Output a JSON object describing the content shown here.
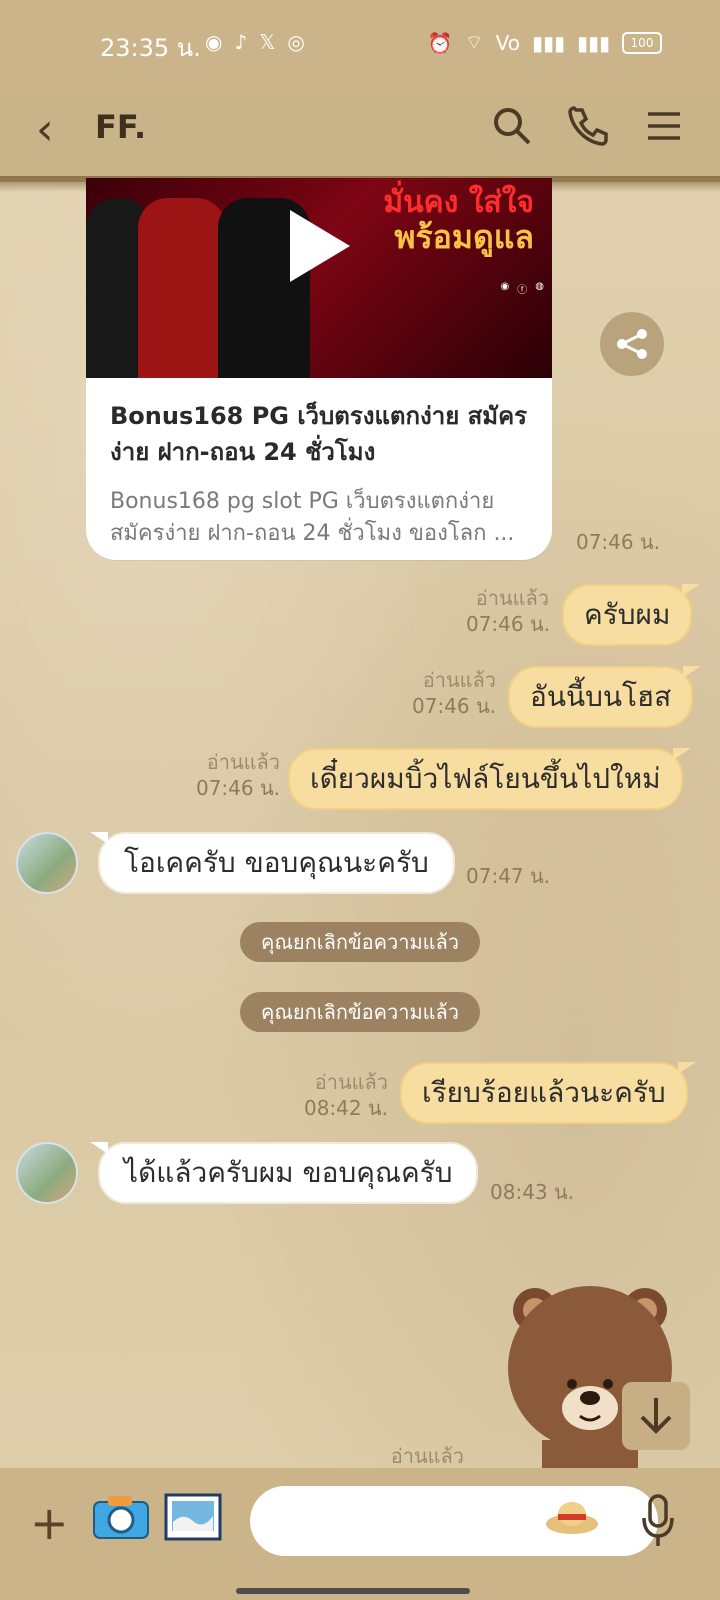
{
  "status_bar": {
    "time": "23:35 น.",
    "apps": [
      "messenger-icon",
      "tiktok-icon",
      "x-icon",
      "instagram-icon"
    ],
    "battery": "100"
  },
  "header": {
    "title": "FF."
  },
  "shared_video": {
    "banner_red": "มั่นคง ใส่ใจ",
    "banner_gold": "พร้อมดูแล",
    "title": "Bonus168 PG เว็บตรงแตกง่าย สมัครง่าย ฝาก-ถอน 24 ชั่วโมง",
    "description": "Bonus168 pg slot PG เว็บตรงแตกง่าย สมัครง่าย ฝาก-ถอน 24 ชั่วโมง ของโลก ...",
    "time": "07:46 น."
  },
  "messages": [
    {
      "side": "mine",
      "text": "ครับผม",
      "read": "อ่านแล้ว",
      "time": "07:46 น."
    },
    {
      "side": "mine",
      "text": "อันนี้บนโฮส",
      "read": "อ่านแล้ว",
      "time": "07:46 น."
    },
    {
      "side": "mine",
      "text": "เดี๋ยวผมบิ้วไฟล์โยนขึ้นไปใหม่",
      "read": "อ่านแล้ว",
      "time": "07:46 น."
    },
    {
      "side": "other",
      "text": "โอเคครับ ขอบคุณนะครับ",
      "time": "07:47 น."
    },
    {
      "side": "system",
      "text": "คุณยกเลิกข้อความแล้ว"
    },
    {
      "side": "system",
      "text": "คุณยกเลิกข้อความแล้ว"
    },
    {
      "side": "mine",
      "text": "เรียบร้อยแล้วนะครับ",
      "read": "อ่านแล้ว",
      "time": "08:42 น."
    },
    {
      "side": "other",
      "text": "ได้แล้วครับผม ขอบคุณครับ",
      "time": "08:43 น."
    }
  ],
  "last_read": "อ่านแล้ว",
  "input": {
    "placeholder": ""
  }
}
